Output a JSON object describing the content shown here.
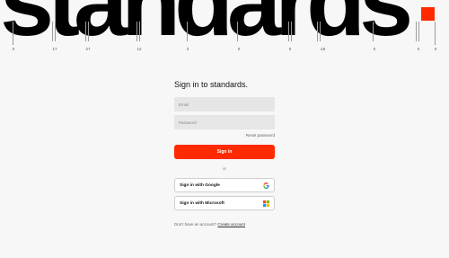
{
  "brand": {
    "wordmark": "standards",
    "accent_color": "#ff2a00"
  },
  "rulers": {
    "numbers": [
      "0",
      "17",
      "27",
      "12",
      "3",
      "0",
      "0",
      "-18",
      "0",
      "0",
      "0"
    ]
  },
  "form": {
    "title": "Sign in to standards.",
    "email_placeholder": "Email",
    "password_placeholder": "Password",
    "reset_label": "Reset password",
    "signin_label": "Sign in",
    "or_label": "or",
    "google_label": "Sign in with Google",
    "google_icon": "google-g-icon",
    "microsoft_label": "Sign in with Microsoft",
    "microsoft_icon": "microsoft-four-squares-icon",
    "signup_prefix": "Don't have an account?",
    "signup_link": "Create account"
  }
}
